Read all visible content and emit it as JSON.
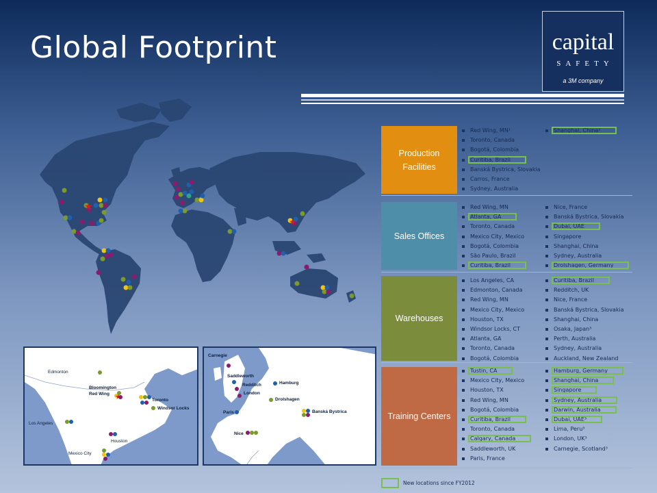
{
  "title": "Global Footprint",
  "logo": {
    "word": "capital",
    "sub": "SAFETY",
    "tag": "a 3M company"
  },
  "colors": {
    "production": "#e18e11",
    "sales": "#4f8ea8",
    "warehouses": "#7b8d3d",
    "training": "#bf6a45",
    "new_outline": "#79bf4e",
    "dot_green": "#7a9a2c",
    "dot_purple": "#8a1b6d",
    "dot_yellow": "#f1c40f",
    "dot_blue": "#1f5fae",
    "dot_teal": "#2aa58c",
    "star_red": "#d61d1d"
  },
  "sections": [
    {
      "label": "Production Facilities",
      "col1": [
        {
          "text": "Red Wing, MN¹",
          "new": false
        },
        {
          "text": "Toronto, Canada",
          "new": false
        },
        {
          "text": "Bogotá, Colombia",
          "new": false
        },
        {
          "text": "Curitiba, Brazil",
          "new": true
        },
        {
          "text": "Banská Bystrica, Slovakia",
          "new": false
        },
        {
          "text": "Carros, France",
          "new": false
        },
        {
          "text": "Sydney, Australia",
          "new": false
        }
      ],
      "col2": [
        {
          "text": "Shanghai, China²",
          "new": true
        }
      ]
    },
    {
      "label": "Sales Offices",
      "col1": [
        {
          "text": "Red Wing, MN",
          "new": false
        },
        {
          "text": "Atlanta, GA",
          "new": true
        },
        {
          "text": "Toronto, Canada",
          "new": false
        },
        {
          "text": "Mexico City, Mexico",
          "new": false
        },
        {
          "text": "Bogotá, Colombia",
          "new": false
        },
        {
          "text": "São Paulo, Brazil",
          "new": false
        },
        {
          "text": "Curitiba, Brazil",
          "new": true
        }
      ],
      "col2": [
        {
          "text": "Nice, France",
          "new": false
        },
        {
          "text": "Banská Bystrica, Slovakia",
          "new": false
        },
        {
          "text": "Dubai, UAE",
          "new": true
        },
        {
          "text": "Singapore",
          "new": false
        },
        {
          "text": "Shanghai, China",
          "new": false
        },
        {
          "text": "Sydney, Australia",
          "new": false
        },
        {
          "text": "Drolshagen, Germany",
          "new": true
        }
      ]
    },
    {
      "label": "Warehouses",
      "col1": [
        {
          "text": "Los Angeles, CA",
          "new": false
        },
        {
          "text": "Edmonton, Canada",
          "new": false
        },
        {
          "text": "Red Wing, MN",
          "new": false
        },
        {
          "text": "Mexico City, Mexico",
          "new": false
        },
        {
          "text": "Houston, TX",
          "new": false
        },
        {
          "text": "Windsor Locks, CT",
          "new": false
        },
        {
          "text": "Atlanta, GA",
          "new": false
        },
        {
          "text": "Toronto, Canada",
          "new": false
        },
        {
          "text": "Bogotá, Colombia",
          "new": false
        }
      ],
      "col2": [
        {
          "text": "Curitiba, Brazil",
          "new": true
        },
        {
          "text": "Redditch, UK",
          "new": false
        },
        {
          "text": "Nice, France",
          "new": false
        },
        {
          "text": "Banská Bystrica, Slovakia",
          "new": false
        },
        {
          "text": "Shanghai, China",
          "new": false
        },
        {
          "text": "Osaka, Japan³",
          "new": false
        },
        {
          "text": "Perth, Australia",
          "new": false
        },
        {
          "text": "Sydney, Australia",
          "new": false
        },
        {
          "text": "Auckland, New Zealand",
          "new": false
        }
      ]
    },
    {
      "label": "Training Centers",
      "col1": [
        {
          "text": "Tustin, CA",
          "new": true
        },
        {
          "text": "Mexico City, Mexico",
          "new": false
        },
        {
          "text": "Houston, TX",
          "new": false
        },
        {
          "text": "Red Wing, MN",
          "new": false
        },
        {
          "text": "Bogotá, Colombia",
          "new": false
        },
        {
          "text": "Curitiba, Brazil",
          "new": true
        },
        {
          "text": "Toronto, Canada",
          "new": false
        },
        {
          "text": "Calgary, Canada",
          "new": true
        },
        {
          "text": "Saddleworth, UK",
          "new": false
        },
        {
          "text": "Paris, France",
          "new": false
        }
      ],
      "col2": [
        {
          "text": "Hamburg, Germany",
          "new": true
        },
        {
          "text": "Shanghai, China",
          "new": true
        },
        {
          "text": "Singapore",
          "new": true
        },
        {
          "text": "Sydney, Australia",
          "new": true
        },
        {
          "text": "Darwin, Australia",
          "new": true
        },
        {
          "text": "Dubai, UAE³",
          "new": true
        },
        {
          "text": "Lima, Peru³",
          "new": false
        },
        {
          "text": "London, UK³",
          "new": false
        },
        {
          "text": "Carnegie, Scotland³",
          "new": false
        }
      ]
    }
  ],
  "inset_na_labels": [
    "Edmonton",
    "Bloomington",
    "Red Wing",
    "Toronto",
    "Windsor Locks",
    "Los Angeles",
    "Houston",
    "Mexico City"
  ],
  "inset_eu_labels": [
    "Carnegie",
    "Saddleworth",
    "Redditch",
    "London",
    "Hamburg",
    "Drolshagen",
    "Paris",
    "Banská Bystrica",
    "Nice"
  ],
  "legend": "New locations since FY2012"
}
